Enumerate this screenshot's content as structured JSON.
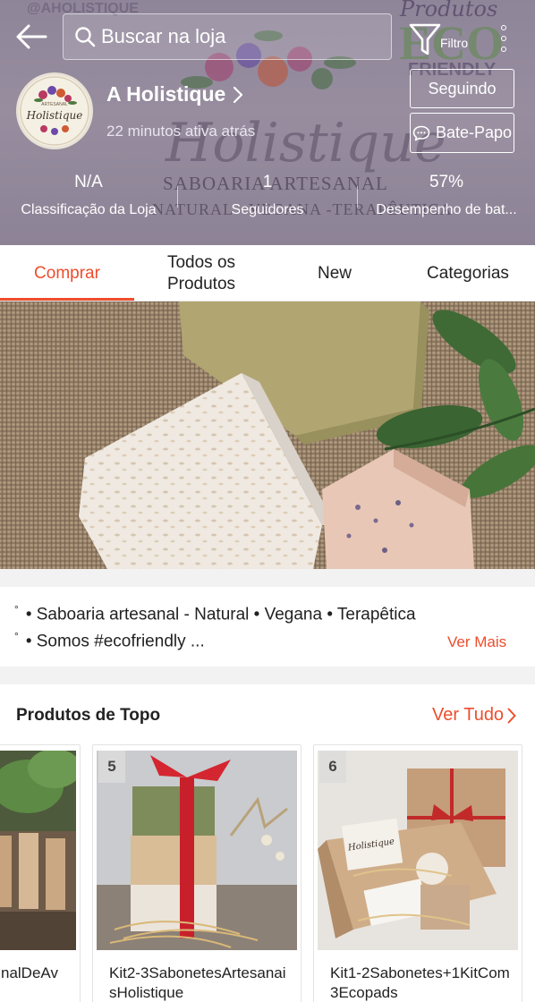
{
  "colors": {
    "accent": "#ee4d2d",
    "header_bg": "#948a9d",
    "page_bg": "#f2f2f2"
  },
  "header": {
    "search_placeholder": "Buscar na loja",
    "filter_label": "Filtro",
    "watermark": {
      "instagram": "@AHOLISTIQUE",
      "script_name": "Holistique",
      "line1": "SABOARIA ARTESANAL",
      "line2": "NATURAL - VEGANA -TERAPÊUTICA",
      "eco_top": "Produtos",
      "eco_mid": "ECO",
      "eco_bottom": "FRIENDLY"
    },
    "avatar_text_top": "ARTESANAL",
    "avatar_text_main": "Holistique",
    "shop_name": "A Holistique",
    "active_status": "22 minutos ativa atrás",
    "follow_label": "Seguindo",
    "chat_label": "Bate-Papo",
    "stats": [
      {
        "value": "N/A",
        "label": "Classificação da Loja"
      },
      {
        "value": "1",
        "label": "Seguidores"
      },
      {
        "value": "57%",
        "label": "Desempenho de bat..."
      }
    ]
  },
  "tabs": [
    {
      "label": "Comprar",
      "active": true
    },
    {
      "label": "Todos os Produtos",
      "active": false
    },
    {
      "label": "New",
      "active": false
    },
    {
      "label": "Categorias",
      "active": false
    }
  ],
  "description": {
    "line1": "• Saboaria artesanal - Natural • Vegana • Terapêtica",
    "line2": "• Somos #ecofriendly ...",
    "bullet_mark": "°",
    "see_more": "Ver Mais"
  },
  "top_products": {
    "title": "Produtos de Topo",
    "see_all": "Ver Tudo",
    "items": [
      {
        "rank": "",
        "name": "nalDeAv"
      },
      {
        "rank": "5",
        "name": "Kit2-3SabonetesArtesanaisHolistique"
      },
      {
        "rank": "6",
        "name": "Kit1-2Sabonetes+1KitCom3Ecopads"
      }
    ],
    "card3_box_label": "Holistique"
  }
}
